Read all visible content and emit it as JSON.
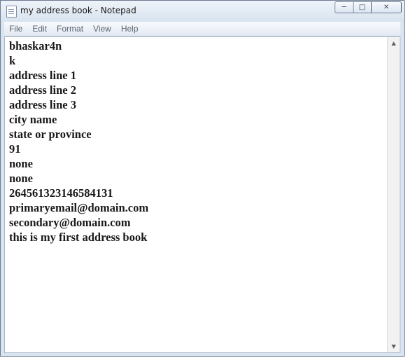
{
  "window": {
    "title": "my address book - Notepad",
    "controls": {
      "minimize": "─",
      "maximize": "□",
      "close": "✕"
    }
  },
  "menu": [
    "File",
    "Edit",
    "Format",
    "View",
    "Help"
  ],
  "document": {
    "lines": [
      "bhaskar4n",
      "k",
      "address line 1",
      "address line 2",
      "address line 3",
      "city name",
      "state or province",
      "91",
      "none",
      "none",
      "264561323146584131",
      "primaryemail@domain.com",
      "secondary@domain.com",
      "this is my first address book"
    ]
  },
  "scrollbar": {
    "up": "▲",
    "down": "▼"
  }
}
